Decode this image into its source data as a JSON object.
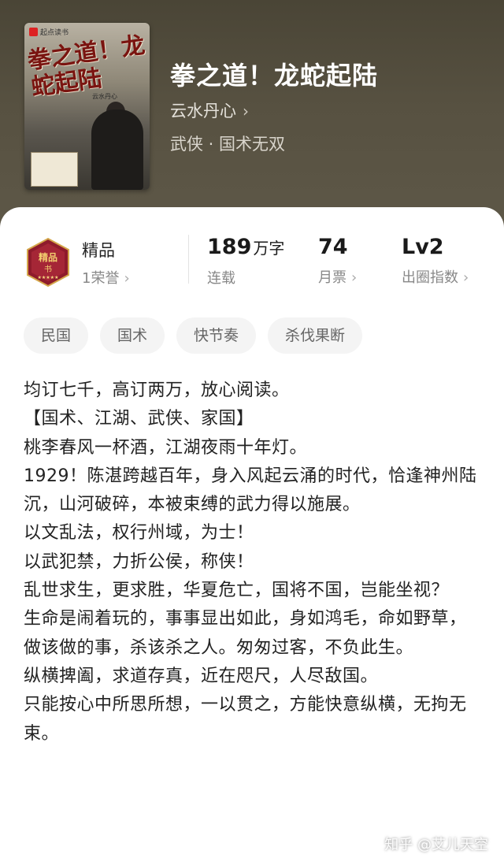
{
  "book": {
    "title": "拳之道！龙蛇起陆",
    "author": "云水丹心",
    "genre": "武侠 · 国术无双",
    "cover": {
      "publisher": "起点读书",
      "title_text": "拳之道！龙蛇起陆",
      "author_text": "云水丹心"
    }
  },
  "stats": {
    "quality": {
      "label": "精品",
      "honor": "1荣誉"
    },
    "word_count": {
      "value": "189",
      "unit": "万字",
      "label": "连载"
    },
    "monthly_tickets": {
      "value": "74",
      "label": "月票"
    },
    "breakout": {
      "value": "Lv2",
      "label": "出圈指数"
    }
  },
  "tags": [
    "民国",
    "国术",
    "快节奏",
    "杀伐果断"
  ],
  "description": [
    "均订七千，高订两万，放心阅读。",
    "【国术、江湖、武侠、家国】",
    "桃李春风一杯酒，江湖夜雨十年灯。",
    "1929！陈湛跨越百年，身入风起云涌的时代，恰逢神州陆沉，山河破碎，本被束缚的武力得以施展。",
    "以文乱法，权行州域，为士！",
    "以武犯禁，力折公侯，称侠！",
    "乱世求生，更求胜，华夏危亡，国将不国，岂能坐视？",
    "生命是闹着玩的，事事显出如此，身如鸿毛，命如野草，做该做的事，杀该杀之人。匆匆过客，不负此生。",
    "纵横捭阖，求道存真，近在咫尺，人尽敌国。",
    "只能按心中所思所想，一以贯之，方能快意纵横，无拘无束。"
  ],
  "watermark": "知乎 @艾儿天空",
  "icons": {
    "chevron": "chevron-right-icon",
    "badge": "quality-badge-icon"
  },
  "colors": {
    "header_bg": "#575141",
    "badge_red": "#9b1d2a"
  }
}
